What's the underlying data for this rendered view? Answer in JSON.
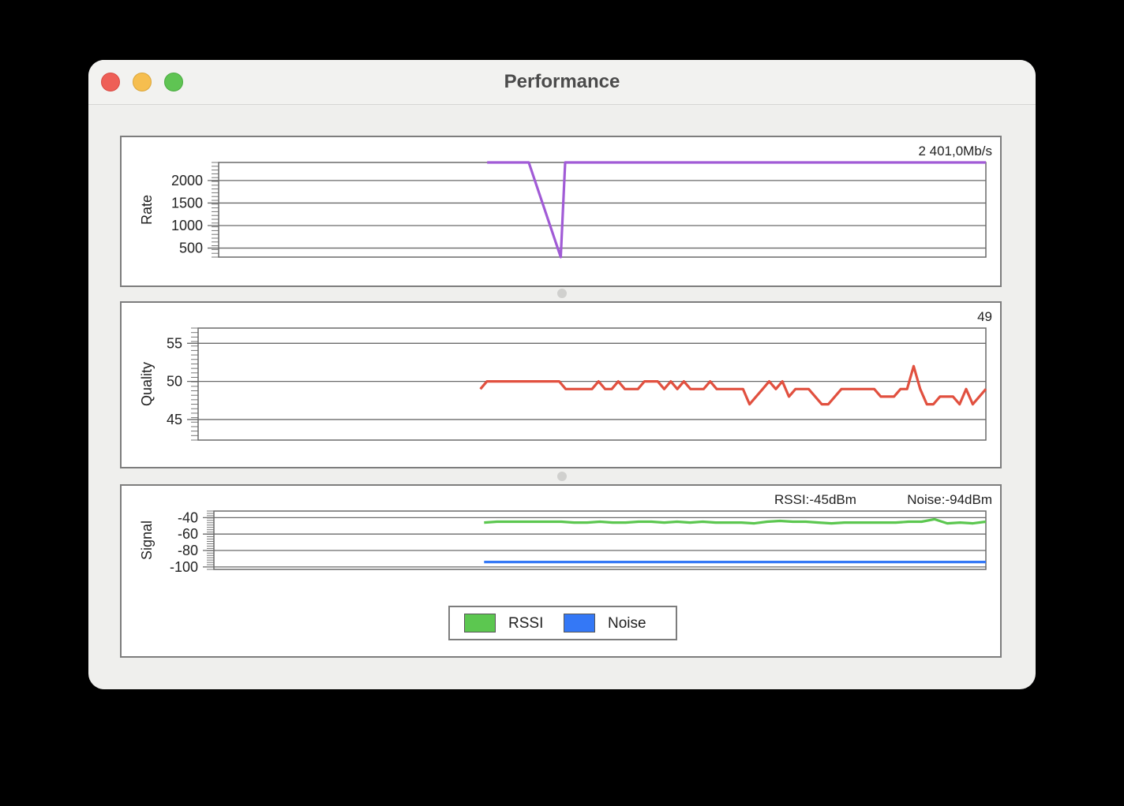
{
  "window": {
    "title": "Performance"
  },
  "rate": {
    "readout": "2 401,0Mb/s",
    "chart_data": {
      "type": "line",
      "ylabel": "Rate",
      "ylim": [
        300,
        2401
      ],
      "yticks": [
        500,
        1000,
        1500,
        2000
      ],
      "ytick_labels": [
        "500",
        "1000",
        "1500",
        "2000"
      ],
      "xlim": [
        0,
        120
      ],
      "series": [
        {
          "color": "#a15bd6",
          "x": [
            42,
            48.5,
            53.5,
            54.2,
            120
          ],
          "values": [
            2401,
            2401,
            300,
            2401,
            2401
          ]
        }
      ]
    }
  },
  "quality": {
    "readout": "49",
    "chart_data": {
      "type": "line",
      "ylabel": "Quality",
      "ylim": [
        42.3,
        57
      ],
      "yticks": [
        45,
        50,
        55
      ],
      "ytick_labels": [
        "45",
        "50",
        "55"
      ],
      "xlim": [
        0,
        120
      ],
      "series": [
        {
          "color": "#e1503f",
          "x": [
            43,
            44,
            45,
            46,
            47,
            48,
            49,
            50,
            51,
            52,
            53,
            54,
            55,
            56,
            57,
            58,
            59,
            60,
            61,
            62,
            63,
            64,
            65,
            66,
            67,
            68,
            69,
            70,
            71,
            72,
            73,
            74,
            75,
            76,
            77,
            78,
            79,
            80,
            81,
            82,
            83,
            84,
            85,
            86,
            87,
            88,
            89,
            90,
            91,
            92,
            93,
            94,
            95,
            96,
            97,
            98,
            99,
            100,
            101,
            102,
            103,
            104,
            105,
            106,
            107,
            108,
            109,
            110,
            111,
            112,
            113,
            114,
            115,
            116,
            117,
            118,
            119,
            120
          ],
          "values": [
            49,
            50,
            50,
            50,
            50,
            50,
            50,
            50,
            50,
            50,
            50,
            50,
            50,
            49,
            49,
            49,
            49,
            49,
            50,
            49,
            49,
            50,
            49,
            49,
            49,
            50,
            50,
            50,
            49,
            50,
            49,
            50,
            49,
            49,
            49,
            50,
            49,
            49,
            49,
            49,
            49,
            47,
            48,
            49,
            50,
            49,
            50,
            48,
            49,
            49,
            49,
            48,
            47,
            47,
            48,
            49,
            49,
            49,
            49,
            49,
            49,
            48,
            48,
            48,
            49,
            49,
            52,
            49,
            47,
            47,
            48,
            48,
            48,
            47,
            49,
            47,
            48,
            49
          ]
        }
      ]
    }
  },
  "signal": {
    "rssi_readout": "RSSI:-45dBm",
    "noise_readout": "Noise:-94dBm",
    "chart_data": {
      "type": "line",
      "ylabel": "Signal",
      "ylim": [
        -103,
        -32
      ],
      "yticks": [
        -100,
        -80,
        -60,
        -40
      ],
      "ytick_labels": [
        "-100",
        "-80",
        "-60",
        "-40"
      ],
      "xlim": [
        0,
        120
      ],
      "series": [
        {
          "name": "RSSI",
          "color": "#5cc750",
          "x": [
            42,
            44,
            46,
            48,
            50,
            52,
            54,
            56,
            58,
            60,
            62,
            64,
            66,
            68,
            70,
            72,
            74,
            76,
            78,
            80,
            82,
            84,
            86,
            88,
            90,
            92,
            94,
            96,
            98,
            100,
            102,
            104,
            106,
            108,
            110,
            112,
            114,
            116,
            118,
            120
          ],
          "values": [
            -46,
            -45,
            -45,
            -45,
            -45,
            -45,
            -45,
            -46,
            -46,
            -45,
            -46,
            -46,
            -45,
            -45,
            -46,
            -45,
            -46,
            -45,
            -46,
            -46,
            -46,
            -47,
            -45,
            -44,
            -45,
            -45,
            -46,
            -47,
            -46,
            -46,
            -46,
            -46,
            -46,
            -45,
            -45,
            -42,
            -47,
            -46,
            -47,
            -45
          ]
        },
        {
          "name": "Noise",
          "color": "#3478f6",
          "x": [
            42,
            120
          ],
          "values": [
            -94,
            -94
          ]
        }
      ]
    },
    "legend": [
      {
        "label": "RSSI",
        "color": "#5cc750"
      },
      {
        "label": "Noise",
        "color": "#3478f6"
      }
    ]
  }
}
